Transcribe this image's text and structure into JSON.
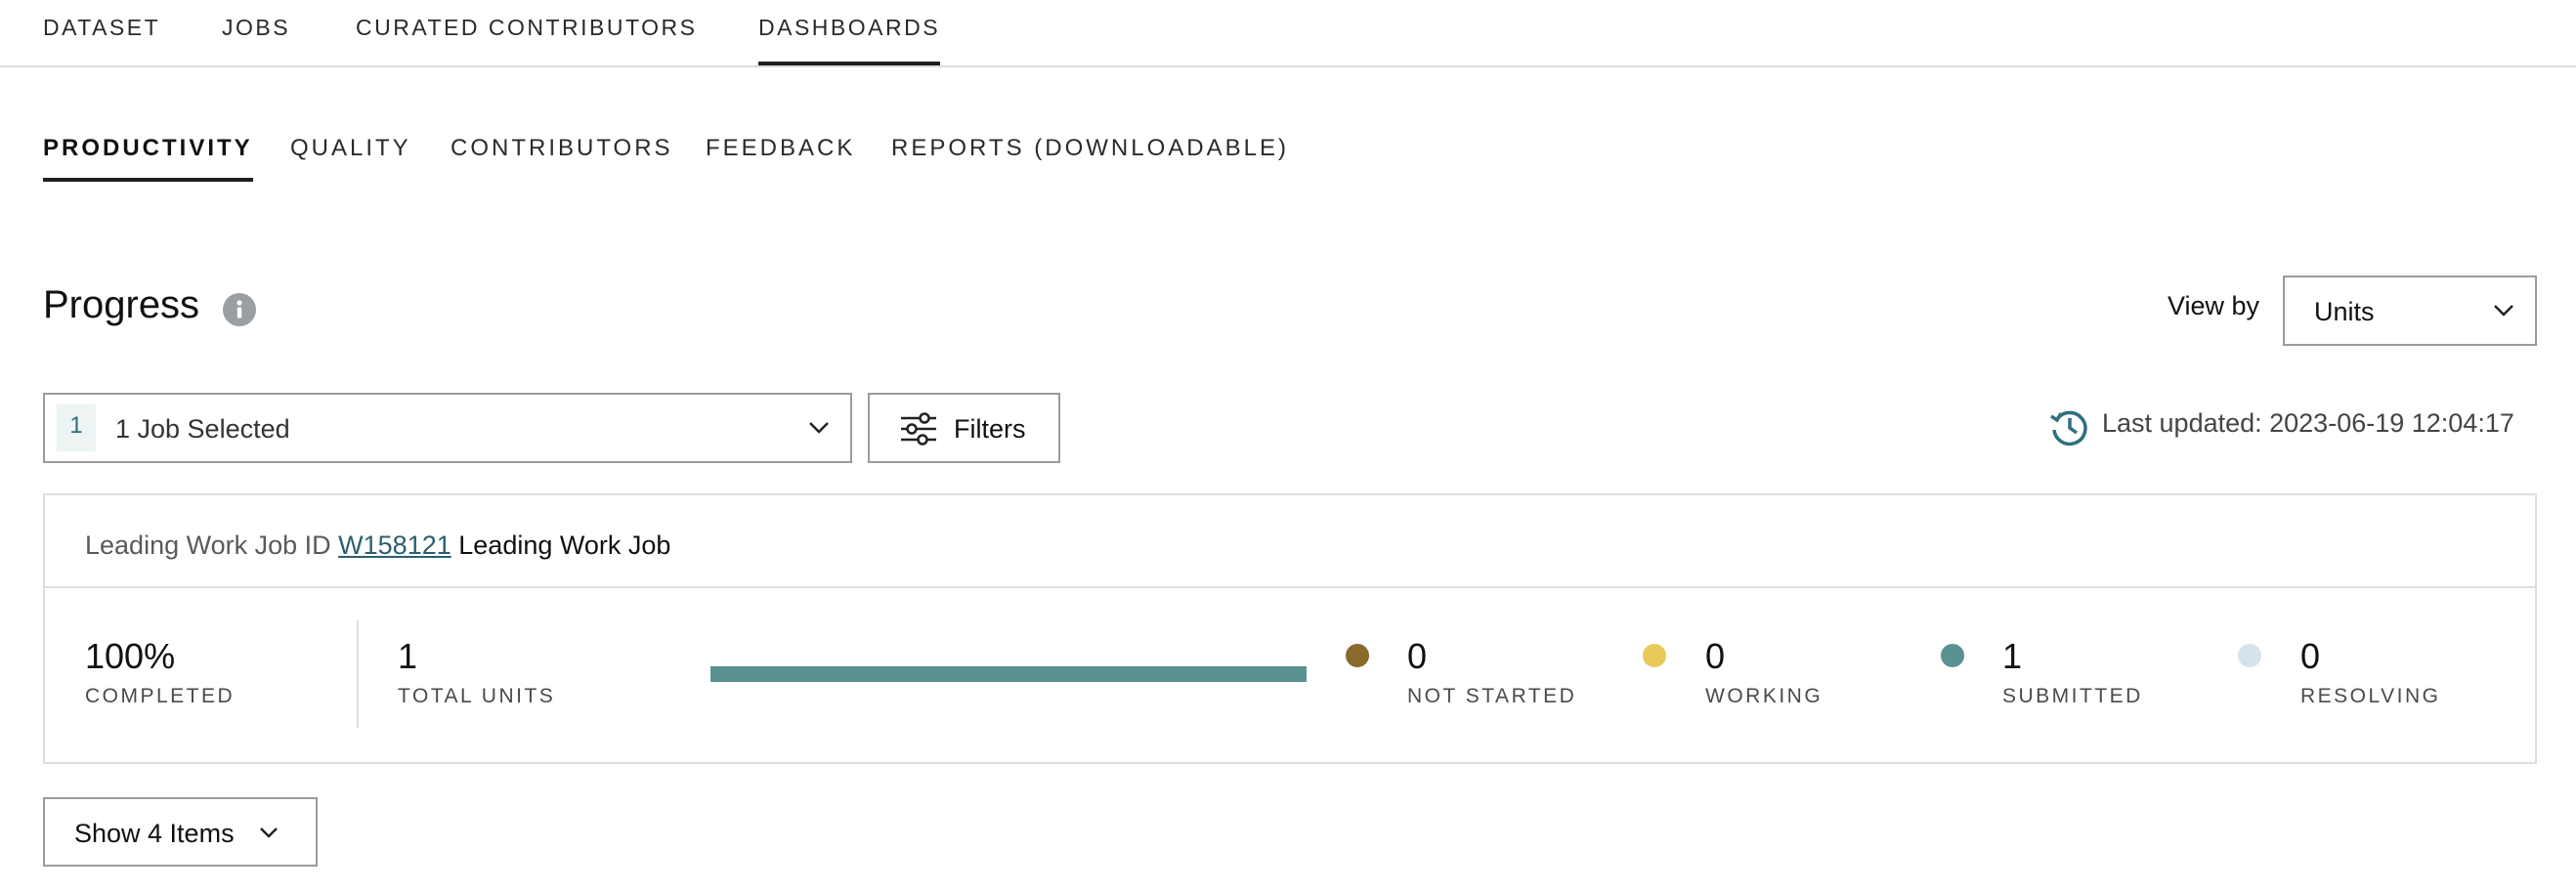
{
  "top_nav": {
    "tabs": [
      {
        "label": "DATASET"
      },
      {
        "label": "JOBS"
      },
      {
        "label": "CURATED CONTRIBUTORS"
      },
      {
        "label": "DASHBOARDS",
        "active": true
      }
    ]
  },
  "sub_nav": {
    "tabs": [
      {
        "label": "PRODUCTIVITY",
        "active": true
      },
      {
        "label": "QUALITY"
      },
      {
        "label": "CONTRIBUTORS"
      },
      {
        "label": "FEEDBACK"
      },
      {
        "label": "REPORTS (DOWNLOADABLE)"
      }
    ]
  },
  "progress": {
    "title": "Progress",
    "info_icon": "info-icon",
    "view_by_label": "View by",
    "view_by_value": "Units"
  },
  "job_selector": {
    "count_badge": "1",
    "value": "1 Job Selected"
  },
  "filters": {
    "label": "Filters",
    "icon": "sliders-icon"
  },
  "last_updated": {
    "text": "Last updated: 2023-06-19 12:04:17",
    "icon": "history-icon"
  },
  "job_card": {
    "job_id_label": "Leading Work Job ID",
    "job_id": "W158121",
    "job_name": "Leading Work Job",
    "completed": {
      "value": "100%",
      "label": "COMPLETED"
    },
    "total_units": {
      "value": "1",
      "label": "TOTAL UNITS"
    },
    "progress_fraction": 1.0,
    "statuses": [
      {
        "value": "0",
        "label": "NOT STARTED",
        "color": "#8a6a2a"
      },
      {
        "value": "0",
        "label": "WORKING",
        "color": "#e9c95a"
      },
      {
        "value": "1",
        "label": "SUBMITTED",
        "color": "#5a9191"
      },
      {
        "value": "0",
        "label": "RESOLVING",
        "color": "#d4e4ea"
      }
    ]
  },
  "show_items": {
    "label": "Show 4 Items"
  },
  "colors": {
    "accent": "#5a9191",
    "link": "#2a5f6e"
  }
}
